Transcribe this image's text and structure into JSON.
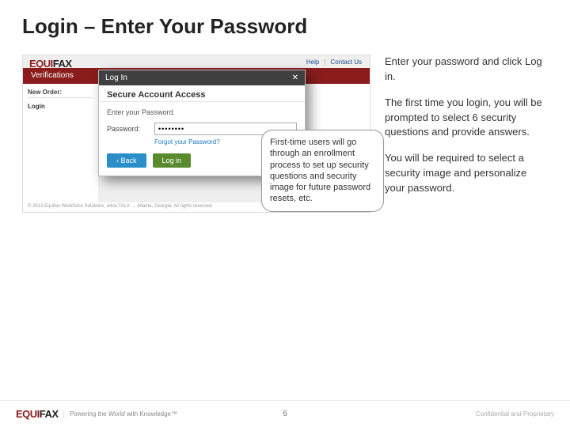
{
  "title": "Login – Enter Your Password",
  "right": {
    "p1": "Enter your password and click Log in.",
    "p2": "The first time you login, you will be prompted to select 6 security questions and provide answers.",
    "p3": "You will be required to select a security image and personalize your password."
  },
  "callout": "First-time users will go through an enrollment process to set up security questions and security image for future password resets, etc.",
  "shot": {
    "help": "Help",
    "contact": "Contact Us",
    "brand1": "EQUI",
    "brand2": "FAX",
    "redband": "Verifications",
    "neworder": "New Order:",
    "login_side": "Login",
    "modal_title": "Log In",
    "modal_sub": "Secure Account Access",
    "prompt": "Enter your Password.",
    "pw_label": "Password:",
    "pw_value": "••••••••",
    "forgot": "Forgot your Password?",
    "btn_back": "Back",
    "btn_login": "Log in",
    "foot": "© 2013 Equifax Workforce Solutions, a/k/a TALX … Atlanta, Georgia. All rights reserved."
  },
  "footer": {
    "brand1": "EQUI",
    "brand2": "FAX",
    "tag_pre": "Powering the ",
    "tag_em": "World",
    "tag_post": " with Knowledge™",
    "page": "6",
    "conf": "Confidential and Proprietary"
  }
}
